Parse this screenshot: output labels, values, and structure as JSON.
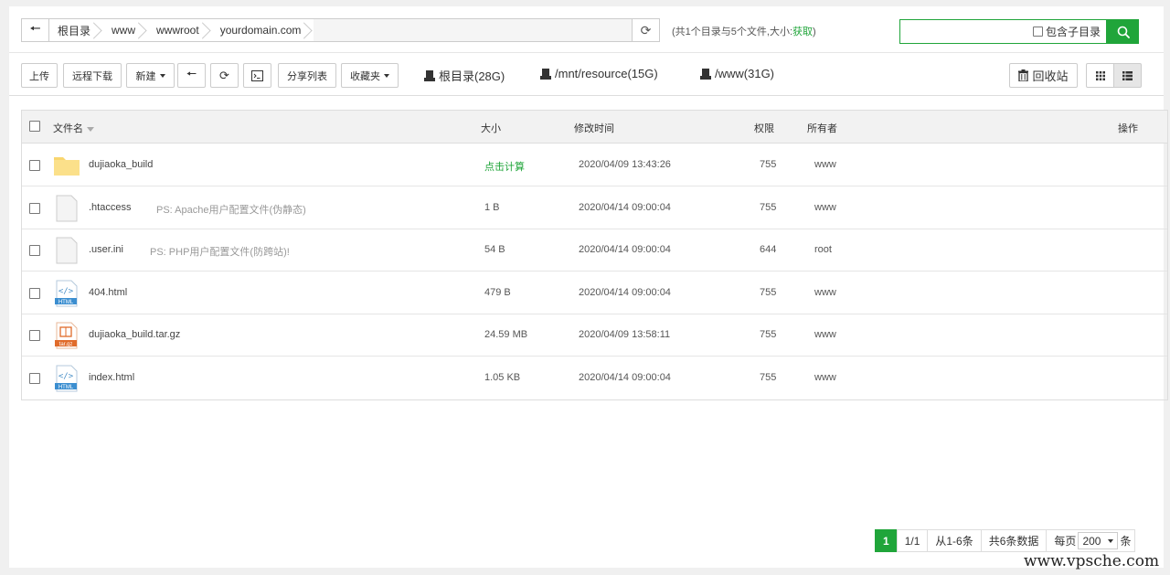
{
  "breadcrumbs": [
    "根目录",
    "www",
    "wwwroot",
    "yourdomain.com"
  ],
  "dir_info": {
    "prefix": "(共1个目录与5个文件,大小:",
    "get_label": "获取",
    "suffix": ")"
  },
  "search": {
    "include_subdir_label": "包含子目录",
    "value": ""
  },
  "toolbar": {
    "upload": "上传",
    "remote_download": "远程下载",
    "new": "新建",
    "share_list": "分享列表",
    "favorites": "收藏夹",
    "recycle_bin": "回收站"
  },
  "disks": [
    "根目录(28G)",
    "/mnt/resource(15G)",
    "/www(31G)"
  ],
  "table": {
    "headers": {
      "name": "文件名",
      "size": "大小",
      "mtime": "修改时间",
      "perm": "权限",
      "owner": "所有者",
      "ops": "操作"
    },
    "rows": [
      {
        "type": "folder",
        "name": "dujiaoka_build",
        "desc": "",
        "size": "点击计算",
        "mtime": "2020/04/09 13:43:26",
        "perm": "755",
        "owner": "www"
      },
      {
        "type": "file",
        "name": ".htaccess",
        "desc": "PS: Apache用户配置文件(伪静态)",
        "size": "1 B",
        "mtime": "2020/04/14 09:00:04",
        "perm": "755",
        "owner": "www"
      },
      {
        "type": "file",
        "name": ".user.ini",
        "desc": "PS: PHP用户配置文件(防跨站)!",
        "size": "54 B",
        "mtime": "2020/04/14 09:00:04",
        "perm": "644",
        "owner": "root"
      },
      {
        "type": "html",
        "name": "404.html",
        "desc": "",
        "size": "479 B",
        "mtime": "2020/04/14 09:00:04",
        "perm": "755",
        "owner": "www"
      },
      {
        "type": "targz",
        "name": "dujiaoka_build.tar.gz",
        "desc": "",
        "size": "24.59 MB",
        "mtime": "2020/04/09 13:58:11",
        "perm": "755",
        "owner": "www"
      },
      {
        "type": "html",
        "name": "index.html",
        "desc": "",
        "size": "1.05 KB",
        "mtime": "2020/04/14 09:00:04",
        "perm": "755",
        "owner": "www"
      }
    ]
  },
  "icon_labels": {
    "html": "HTML",
    "targz": "tar.gz"
  },
  "pager": {
    "current": "1",
    "pages": "1/1",
    "range": "从1-6条",
    "total": "共6条数据",
    "per_page_label": "每页",
    "per_page": "200",
    "unit": "条"
  },
  "watermark": "www.vpsche.com",
  "colors": {
    "accent": "#20a53a",
    "folder": "#f9d66f"
  }
}
